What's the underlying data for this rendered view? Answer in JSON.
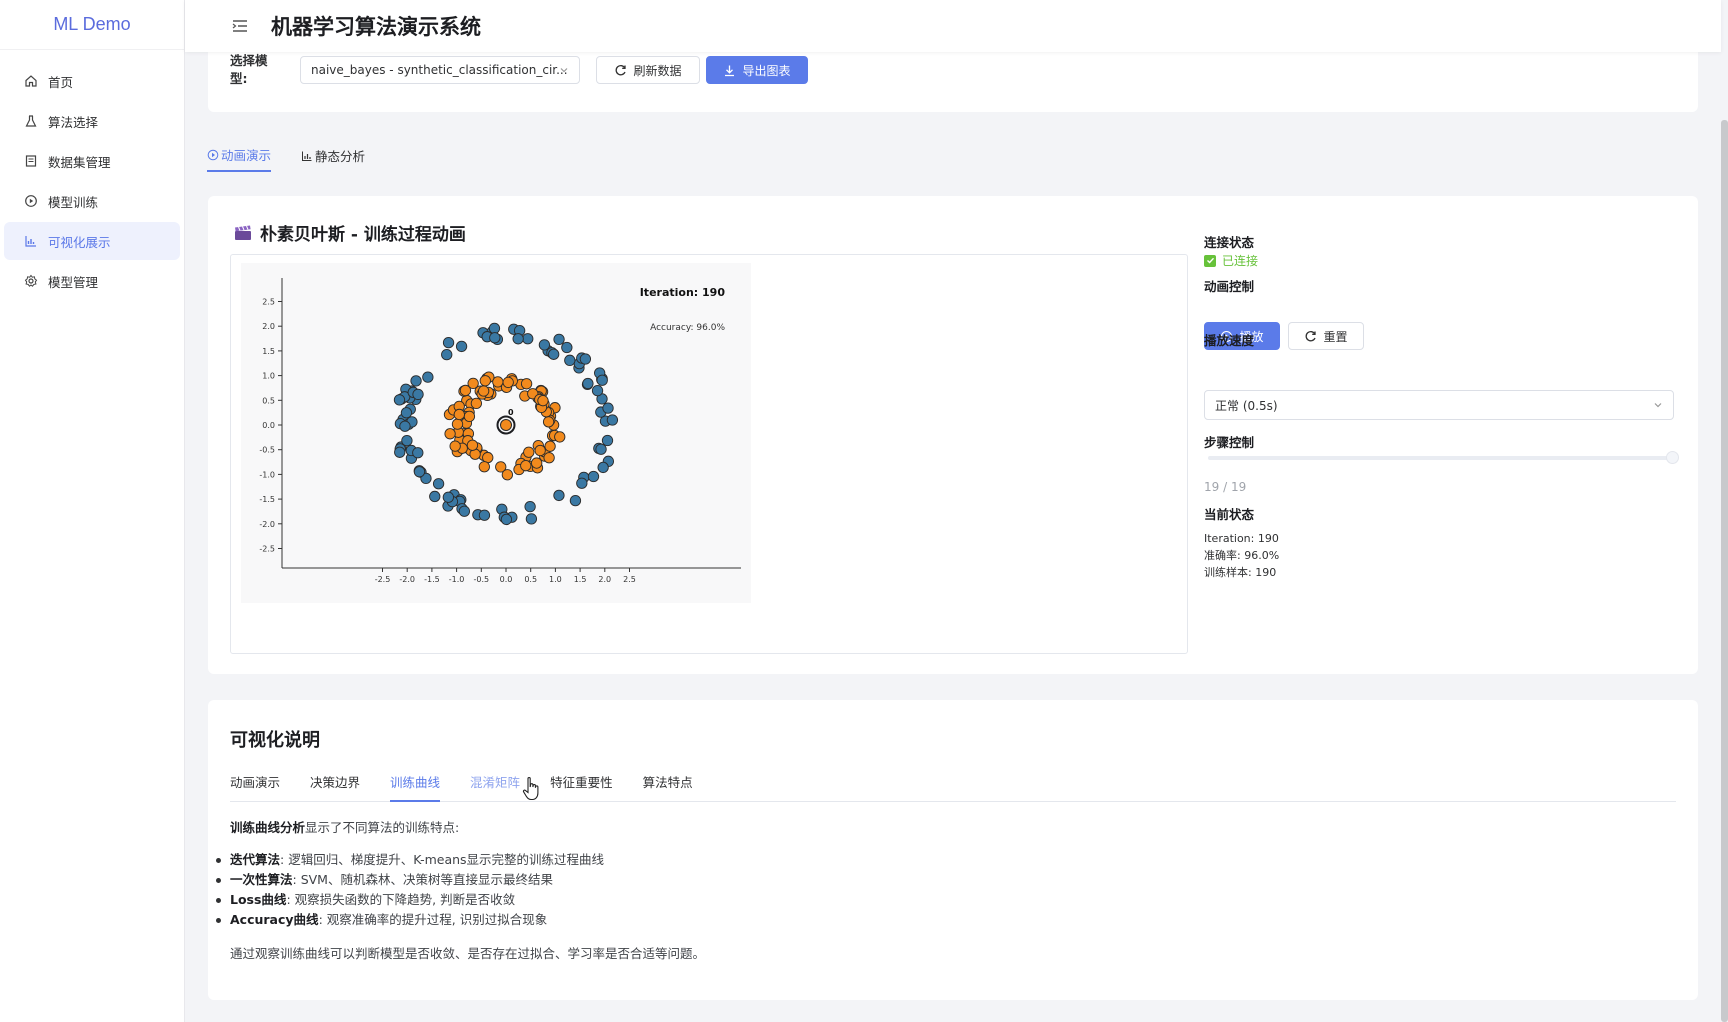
{
  "app": {
    "logo": "ML Demo",
    "title": "机器学习算法演示系统"
  },
  "sidebar": {
    "items": [
      {
        "label": "首页",
        "icon": "home-icon"
      },
      {
        "label": "算法选择",
        "icon": "flask-icon"
      },
      {
        "label": "数据集管理",
        "icon": "database-icon"
      },
      {
        "label": "模型训练",
        "icon": "play-circle-icon"
      },
      {
        "label": "可视化展示",
        "icon": "chart-icon",
        "active": true
      },
      {
        "label": "模型管理",
        "icon": "gear-icon"
      }
    ]
  },
  "toolbar": {
    "model_label": "选择模型:",
    "model_value": "naive_bayes - synthetic_classification_cir...",
    "refresh_label": "刷新数据",
    "export_label": "导出图表"
  },
  "view_tabs": [
    {
      "label": "动画演示",
      "active": true
    },
    {
      "label": "静态分析",
      "active": false
    }
  ],
  "animation": {
    "title": "朴素贝叶斯 - 训练过程动画",
    "connection_label": "连接状态",
    "connection_value": "已连接",
    "control_label": "动画控制",
    "play_label": "播放",
    "reset_label": "重置",
    "speed_label": "播放速度",
    "speed_value": "正常 (0.5s)",
    "step_label": "步骤控制",
    "step_count": "19 / 19",
    "state_label": "当前状态",
    "state_iteration": "Iteration: 190",
    "state_accuracy": "准确率: 96.0%",
    "state_samples": "训练样本: 190"
  },
  "chart_data": {
    "type": "scatter",
    "title": "",
    "xlabel": "",
    "ylabel": "",
    "annotations": [
      "Iteration: 190",
      "Accuracy: 96.0%"
    ],
    "xlim": [
      -3,
      3
    ],
    "ylim": [
      -3,
      3
    ],
    "x_ticks": [
      -2.5,
      -2.0,
      -1.5,
      -1.0,
      -0.5,
      0.0,
      0.5,
      1.0,
      1.5,
      2.0,
      2.5
    ],
    "y_ticks": [
      -2.5,
      -2.0,
      -1.5,
      -1.0,
      -0.5,
      0.0,
      0.5,
      1.0,
      1.5,
      2.0,
      2.5
    ],
    "grid": false,
    "series_colors": {
      "outer": "#3a78a3",
      "inner": "#f28a1d",
      "current": "#1d1e22"
    },
    "current_point": {
      "x": 0.0,
      "y": 0.0,
      "label": "0"
    },
    "outer_ring": {
      "approx_radius": [
        1.85,
        2.2
      ],
      "count": 95
    },
    "inner_ring": {
      "approx_radius": [
        0.75,
        1.15
      ],
      "count": 95
    }
  },
  "description": {
    "title": "可视化说明",
    "tabs": [
      {
        "label": "动画演示",
        "state": ""
      },
      {
        "label": "决策边界",
        "state": ""
      },
      {
        "label": "训练曲线",
        "state": "active"
      },
      {
        "label": "混淆矩阵",
        "state": "hover"
      },
      {
        "label": "特征重要性",
        "state": ""
      },
      {
        "label": "算法特点",
        "state": ""
      }
    ],
    "intro_bold": "训练曲线分析",
    "intro_rest": "显示了不同算法的训练特点:",
    "bullets": [
      {
        "bold": "迭代算法",
        "text": ": 逻辑回归、梯度提升、K-means显示完整的训练过程曲线"
      },
      {
        "bold": "一次性算法",
        "text": ": SVM、随机森林、决策树等直接显示最终结果"
      },
      {
        "bold": "Loss曲线",
        "text": ": 观察损失函数的下降趋势, 判断是否收敛"
      },
      {
        "bold": "Accuracy曲线",
        "text": ": 观察准确率的提升过程, 识别过拟合现象"
      }
    ],
    "footer": "通过观察训练曲线可以判断模型是否收敛、是否存在过拟合、学习率是否合适等问题。"
  }
}
